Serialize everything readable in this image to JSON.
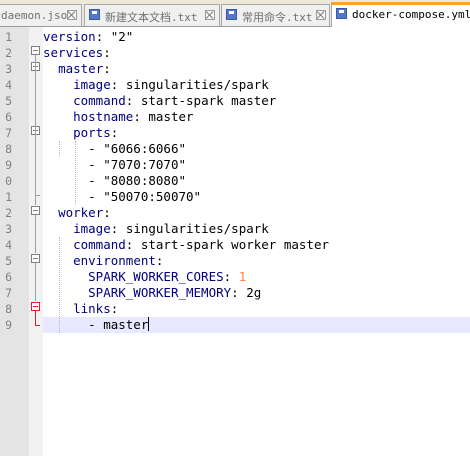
{
  "tabs": [
    {
      "label": "daemon.json",
      "active": false
    },
    {
      "label": "新建文本文档.txt",
      "active": false
    },
    {
      "label": "常用命令.txt",
      "active": false
    },
    {
      "label": "docker-compose.yml",
      "active": true
    }
  ],
  "lines": [
    {
      "num": "1",
      "indent": "",
      "key": "version",
      "sep": ": ",
      "value": "\"2\""
    },
    {
      "num": "2",
      "indent": "",
      "key": "services",
      "sep": ":",
      "value": ""
    },
    {
      "num": "3",
      "indent": "  ",
      "key": "master",
      "sep": ":",
      "value": ""
    },
    {
      "num": "4",
      "indent": "    ",
      "key": "image",
      "sep": ": ",
      "value": "singularities/spark"
    },
    {
      "num": "5",
      "indent": "    ",
      "key": "command",
      "sep": ": ",
      "value": "start-spark master"
    },
    {
      "num": "6",
      "indent": "    ",
      "key": "hostname",
      "sep": ": ",
      "value": "master"
    },
    {
      "num": "7",
      "indent": "    ",
      "key": "ports",
      "sep": ":",
      "value": ""
    },
    {
      "num": "8",
      "indent": "      ",
      "key": "",
      "sep": "",
      "value": "- \"6066:6066\""
    },
    {
      "num": "9",
      "indent": "      ",
      "key": "",
      "sep": "",
      "value": "- \"7070:7070\""
    },
    {
      "num": "0",
      "indent": "      ",
      "key": "",
      "sep": "",
      "value": "- \"8080:8080\""
    },
    {
      "num": "1",
      "indent": "      ",
      "key": "",
      "sep": "",
      "value": "- \"50070:50070\""
    },
    {
      "num": "2",
      "indent": "  ",
      "key": "worker",
      "sep": ":",
      "value": ""
    },
    {
      "num": "3",
      "indent": "    ",
      "key": "image",
      "sep": ": ",
      "value": "singularities/spark"
    },
    {
      "num": "4",
      "indent": "    ",
      "key": "command",
      "sep": ": ",
      "value": "start-spark worker master"
    },
    {
      "num": "5",
      "indent": "    ",
      "key": "environment",
      "sep": ":",
      "value": ""
    },
    {
      "num": "6",
      "indent": "      ",
      "key": "SPARK_WORKER_CORES",
      "sep": ": ",
      "value": "1",
      "numeric": true
    },
    {
      "num": "7",
      "indent": "      ",
      "key": "SPARK_WORKER_MEMORY",
      "sep": ": ",
      "value": "2g"
    },
    {
      "num": "8",
      "indent": "    ",
      "key": "links",
      "sep": ":",
      "value": ""
    },
    {
      "num": "9",
      "indent": "      ",
      "key": "",
      "sep": "",
      "value": "- master",
      "caret": true
    }
  ]
}
